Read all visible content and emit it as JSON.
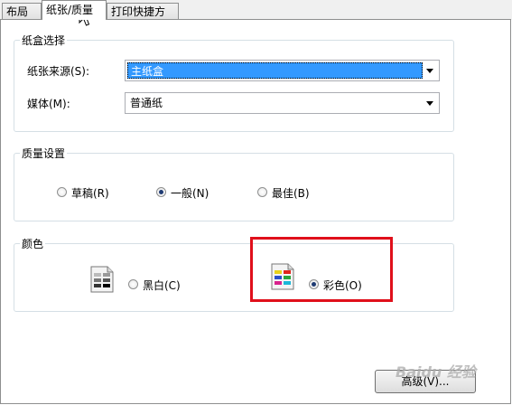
{
  "tabs": [
    {
      "label": "布局",
      "active": false
    },
    {
      "label": "纸张/质量",
      "active": true
    },
    {
      "label": "打印快捷方式",
      "active": false
    }
  ],
  "paper_tray": {
    "legend": "纸盒选择",
    "source_label": "纸张来源(S):",
    "source_value": "主纸盒",
    "media_label": "媒体(M):",
    "media_value": "普通纸"
  },
  "quality": {
    "legend": "质量设置",
    "options": [
      {
        "label": "草稿(R)",
        "checked": false
      },
      {
        "label": "一般(N)",
        "checked": true
      },
      {
        "label": "最佳(B)",
        "checked": false
      }
    ]
  },
  "color": {
    "legend": "颜色",
    "options": [
      {
        "label": "黑白(C)",
        "checked": false,
        "icon": "grayscale-printer-icon"
      },
      {
        "label": "彩色(O)",
        "checked": true,
        "icon": "color-printer-icon"
      }
    ]
  },
  "advanced_button": "高级(V)...",
  "watermark": "Baidu 经验",
  "colors": {
    "highlight": "#3399ff",
    "annotation": "#e0101b"
  }
}
